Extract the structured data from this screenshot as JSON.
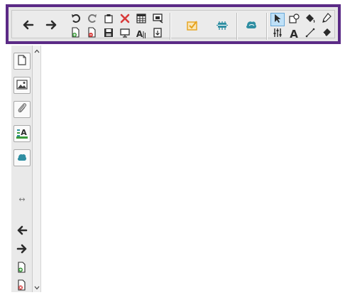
{
  "colors": {
    "frame": "#5b2a86",
    "toolbar_bg": "#ebebeb",
    "icon_dark": "#2b2b2b",
    "delete_red": "#d83a3a",
    "add_green": "#3a9a3a",
    "remove_red": "#d83a3a",
    "highlight_orange": "#e6a21b",
    "teal": "#2f8ea2",
    "pressed_bg": "#bfe0f7"
  },
  "toolbar": {
    "icons": [
      "arrow-left-icon",
      "arrow-right-icon",
      "undo-icon",
      "redo-icon",
      "paste-icon",
      "delete-icon",
      "table-icon",
      "screen-capture-icon",
      "add-page-icon",
      "remove-page-icon",
      "save-icon",
      "screen-display-icon",
      "handwriting-recognition-icon",
      "insert-box-icon",
      "check-box-icon",
      "creative-pen-icon",
      "magic-ink-icon",
      "select-cursor-icon",
      "shapes-icon",
      "fill-icon",
      "pen-icon",
      "properties-icon",
      "text-icon",
      "line-icon",
      "eraser-icon"
    ],
    "text_tool_label": "A",
    "handwriting_label": "A",
    "active_tool": "select-cursor-icon"
  },
  "sidebar": {
    "icons": [
      "page-sorter-icon",
      "gallery-icon",
      "attachments-icon",
      "properties-icon",
      "add-ons-icon",
      "swap-sides-icon",
      "previous-page-icon",
      "next-page-icon",
      "add-page-icon",
      "delete-page-icon"
    ],
    "properties_label": "A",
    "swap_label": "↔"
  }
}
